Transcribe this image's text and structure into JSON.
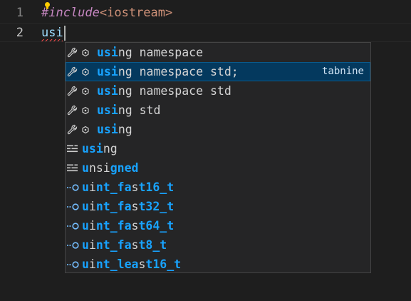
{
  "editor": {
    "lines": [
      {
        "number": "1",
        "directive": "#include",
        "path": "<iostream>"
      },
      {
        "number": "2",
        "text": "usi"
      }
    ]
  },
  "suggestions": [
    {
      "kind": "tabnine",
      "label_match": "usi",
      "label_rest": "ng namespace",
      "detail": "",
      "selected": false
    },
    {
      "kind": "tabnine",
      "label_match": "usi",
      "label_rest": "ng namespace std;",
      "detail": "tabnine",
      "selected": true
    },
    {
      "kind": "tabnine",
      "label_match": "usi",
      "label_rest": "ng namespace std",
      "detail": "",
      "selected": false
    },
    {
      "kind": "tabnine",
      "label_match": "usi",
      "label_rest": "ng std",
      "detail": "",
      "selected": false
    },
    {
      "kind": "tabnine",
      "label_match": "usi",
      "label_rest": "ng",
      "detail": "",
      "selected": false
    },
    {
      "kind": "keyword",
      "parts": [
        "usi",
        "ng"
      ]
    },
    {
      "kind": "keyword",
      "parts": [
        "u",
        "nsi",
        "gned"
      ]
    },
    {
      "kind": "typedef",
      "parts": [
        "u",
        "i",
        "nt_fa",
        "s",
        "t16_t"
      ]
    },
    {
      "kind": "typedef",
      "parts": [
        "u",
        "i",
        "nt_fa",
        "s",
        "t32_t"
      ]
    },
    {
      "kind": "typedef",
      "parts": [
        "u",
        "i",
        "nt_fa",
        "s",
        "t64_t"
      ]
    },
    {
      "kind": "typedef",
      "parts": [
        "u",
        "i",
        "nt_fa",
        "s",
        "t8_t"
      ]
    },
    {
      "kind": "typedef",
      "parts": [
        "u",
        "i",
        "nt_lea",
        "s",
        "t16_t"
      ]
    }
  ],
  "icons": {
    "tabnine": [
      "wrench-icon",
      "circle-icon"
    ],
    "keyword": "keyword-icon",
    "typedef": "typedef-icon"
  },
  "colors": {
    "background": "#1e1e1e",
    "widget_background": "#252526",
    "selected_row": "#04395e",
    "match_highlight": "#18a3ff",
    "directive": "#c586c0",
    "include_path": "#ce9178",
    "identifier": "#9cdcfe",
    "error_squiggle": "#f14c4c"
  }
}
